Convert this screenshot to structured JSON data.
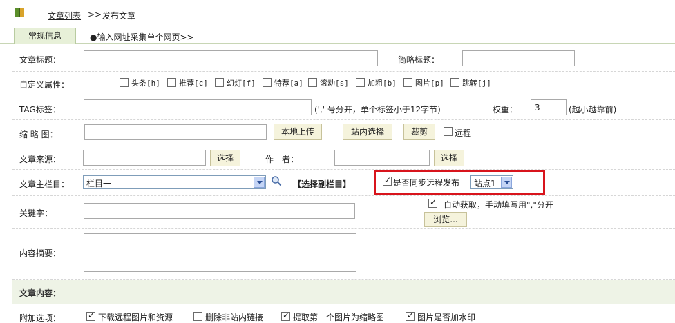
{
  "breadcrumb": {
    "list_link": "文章列表",
    "separator": ">>",
    "current": "发布文章"
  },
  "tabs": {
    "active": "常规信息",
    "other": "●输入网址采集单个网页>>"
  },
  "form": {
    "title_label": "文章标题：",
    "short_title_label": "简略标题：",
    "custom_attr_label": "自定义属性：",
    "attributes": [
      {
        "label": "头条[h]",
        "checked": false
      },
      {
        "label": "推荐[c]",
        "checked": false
      },
      {
        "label": "幻灯[f]",
        "checked": false
      },
      {
        "label": "特荐[a]",
        "checked": false
      },
      {
        "label": "滚动[s]",
        "checked": false
      },
      {
        "label": "加粗[b]",
        "checked": false
      },
      {
        "label": "图片[p]",
        "checked": false
      },
      {
        "label": "跳转[j]",
        "checked": false
      }
    ],
    "tag_label": "TAG标签：",
    "tag_hint": "(',' 号分开，单个标签小于12字节)",
    "weight_label": "权重：",
    "weight_value": "3",
    "weight_hint": "(越小越靠前)",
    "thumb_label": "缩 略 图：",
    "local_upload_btn": "本地上传",
    "site_select_btn": "站内选择",
    "crop_btn": "裁剪",
    "remote_label": "远程",
    "source_label": "文章来源：",
    "source_select_btn": "选择",
    "author_label": "作　者：",
    "author_select_btn": "选择",
    "column_label": "文章主栏目：",
    "column_value": "栏目一",
    "sub_column_link": "【选择副栏目】",
    "sync_label": "是否同步远程发布",
    "sync_checked": true,
    "site_value": "站点1",
    "keywords_label": "关键字：",
    "auto_get_label": "自动获取，手动填写用\",\"分开",
    "auto_get_checked": true,
    "browse_btn": "浏览...",
    "summary_label": "内容摘要：",
    "content_section": "文章内容：",
    "extra_label": "附加选项：",
    "extra_options": [
      {
        "label": "下载远程图片和资源",
        "checked": true
      },
      {
        "label": "删除非站内链接",
        "checked": false
      },
      {
        "label": "提取第一个图片为缩略图",
        "checked": true
      },
      {
        "label": "图片是否加水印",
        "checked": true
      }
    ]
  }
}
